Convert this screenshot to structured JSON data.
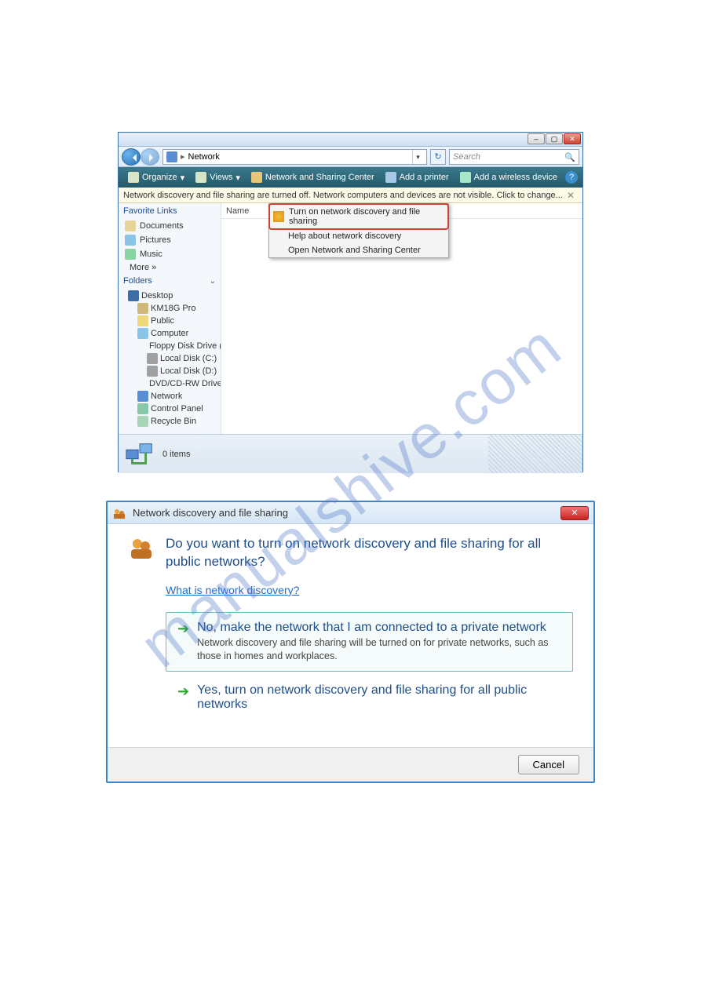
{
  "watermark": "manualshive.com",
  "explorer": {
    "address": {
      "crumb": "Network"
    },
    "search": {
      "placeholder": "Search"
    },
    "cmdbar": {
      "organize": "Organize",
      "views": "Views",
      "network_center": "Network and Sharing Center",
      "add_printer": "Add a printer",
      "add_wireless": "Add a wireless device"
    },
    "infobar": "Network discovery and file sharing are turned off. Network computers and devices are not visible. Click to change...",
    "favorites_hdr": "Favorite Links",
    "favorites": {
      "documents": "Documents",
      "pictures": "Pictures",
      "music": "Music",
      "more": "More  »"
    },
    "folders_hdr": "Folders",
    "tree": {
      "desktop": "Desktop",
      "user": "KM18G Pro",
      "public": "Public",
      "computer": "Computer",
      "floppy": "Floppy Disk Drive (A",
      "localc": "Local Disk (C:)",
      "locald": "Local Disk (D:)",
      "dvd": "DVD/CD-RW Drive (",
      "network": "Network",
      "cpanel": "Control Panel",
      "recycle": "Recycle Bin"
    },
    "column_name": "Name",
    "context": {
      "turn_on": "Turn on network discovery and file sharing",
      "help": "Help about network discovery",
      "open_center": "Open Network and Sharing Center"
    },
    "status": "0 items"
  },
  "dialog": {
    "title": "Network discovery and file sharing",
    "heading": "Do you want to turn on network discovery and file sharing for all public networks?",
    "link": "What is network discovery?",
    "option1_title": "No, make the network that I am connected to a private network",
    "option1_desc": "Network discovery and file sharing will be turned on for private networks, such as those in homes and workplaces.",
    "option2_title": "Yes, turn on network discovery and file sharing for all public networks",
    "cancel": "Cancel"
  }
}
